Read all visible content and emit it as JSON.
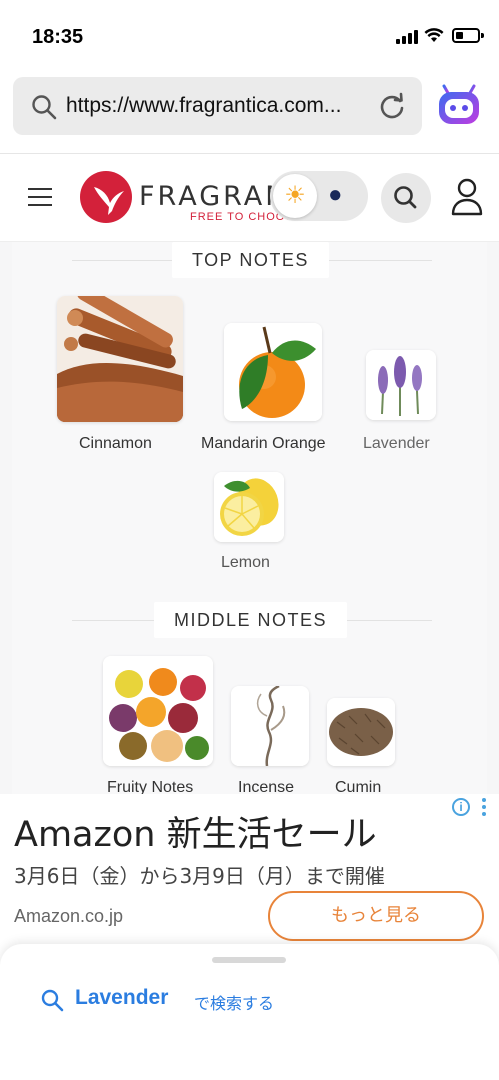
{
  "status_bar": {
    "time": "18:35"
  },
  "browser": {
    "url": "https://www.fragrantica.com..."
  },
  "site_header": {
    "logo_text": "FRAGRANTICA",
    "tagline": "FREE TO CHOOSE"
  },
  "top_notes": {
    "title": "TOP NOTES",
    "items": [
      {
        "label": "Cinnamon"
      },
      {
        "label": "Mandarin Orange"
      },
      {
        "label": "Lavender"
      },
      {
        "label": "Lemon"
      }
    ]
  },
  "middle_notes": {
    "title": "MIDDLE NOTES",
    "items": [
      {
        "label": "Fruity Notes"
      },
      {
        "label": "Incense"
      },
      {
        "label": "Cumin"
      }
    ]
  },
  "ad": {
    "title": "Amazon 新生活セール",
    "subtitle": "3月6日（金）から3月9日（月）まで開催",
    "domain": "Amazon.co.jp",
    "button_label": "もっと見る",
    "info_glyph": "i"
  },
  "lookup": {
    "term": "Lavender",
    "action": "で検索する"
  },
  "colors": {
    "brand": "#d3213a",
    "ad_accent": "#e8843a",
    "lookup_blue": "#2b7de0"
  }
}
